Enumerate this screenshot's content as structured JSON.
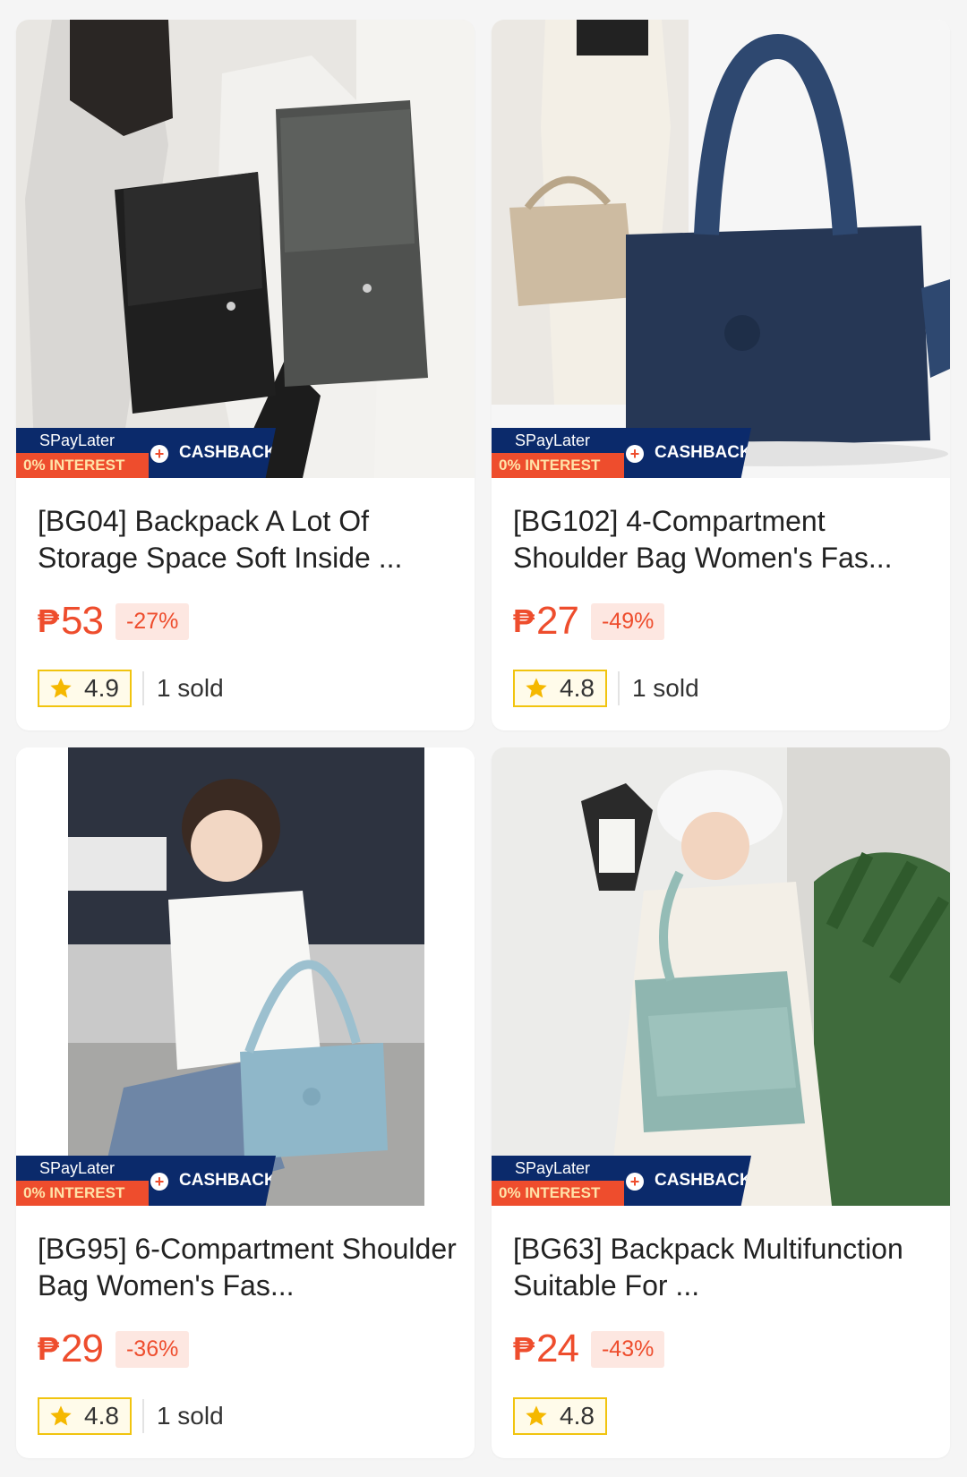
{
  "products": [
    {
      "title": "[BG04] Backpack A Lot Of Storage Space Soft Inside ...",
      "currency": "₱",
      "price": "53",
      "discount": "-27%",
      "rating": "4.9",
      "sold": "1 sold",
      "promo": {
        "spaylater": "SPayLater",
        "interest": "0% INTEREST",
        "cashback": "CASHBACK"
      }
    },
    {
      "title": "[BG102] 4-Compartment Shoulder Bag Women's Fas...",
      "currency": "₱",
      "price": "27",
      "discount": "-49%",
      "rating": "4.8",
      "sold": "1 sold",
      "promo": {
        "spaylater": "SPayLater",
        "interest": "0% INTEREST",
        "cashback": "CASHBACK"
      }
    },
    {
      "title": "[BG95] 6-Compartment Shoulder Bag Women's Fas...",
      "currency": "₱",
      "price": "29",
      "discount": "-36%",
      "rating": "4.8",
      "sold": "1 sold",
      "promo": {
        "spaylater": "SPayLater",
        "interest": "0% INTEREST",
        "cashback": "CASHBACK"
      }
    },
    {
      "title": "[BG63] Backpack Multifunction Suitable For ...",
      "currency": "₱",
      "price": "24",
      "discount": "-43%",
      "rating": "4.8",
      "sold": "",
      "promo": {
        "spaylater": "SPayLater",
        "interest": "0% INTEREST",
        "cashback": "CASHBACK"
      }
    }
  ],
  "icons": {
    "rating": "star-icon",
    "promo": "plus-circle-icon"
  },
  "colors": {
    "price": "#ee4d2d",
    "promo_navy": "#0b2a6b",
    "rating_border": "#f1c40f"
  }
}
